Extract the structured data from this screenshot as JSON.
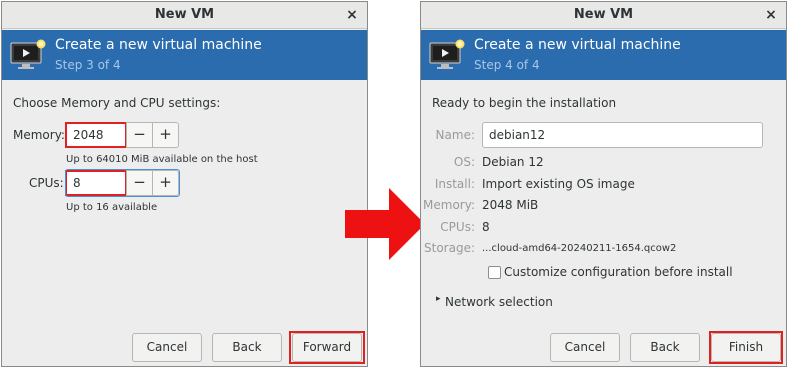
{
  "left": {
    "window_title": "New VM",
    "close_glyph": "×",
    "banner_title": "Create a new virtual machine",
    "banner_step": "Step 3 of 4",
    "heading": "Choose Memory and CPU settings:",
    "memory_label": "Memory:",
    "memory_value": "2048",
    "memory_hint": "Up to 64010 MiB available on the host",
    "cpus_label": "CPUs:",
    "cpus_value": "8",
    "cpus_hint": "Up to 16 available",
    "minus_glyph": "−",
    "plus_glyph": "+",
    "buttons": {
      "cancel": "Cancel",
      "back": "Back",
      "forward": "Forward"
    }
  },
  "right": {
    "window_title": "New VM",
    "close_glyph": "×",
    "banner_title": "Create a new virtual machine",
    "banner_step": "Step 4 of 4",
    "heading": "Ready to begin the installation",
    "name_label": "Name:",
    "name_value": "debian12",
    "os_label": "OS:",
    "os_value": "Debian 12",
    "install_label": "Install:",
    "install_value": "Import existing OS image",
    "memory_label": "Memory:",
    "memory_value": "2048 MiB",
    "cpus_label": "CPUs:",
    "cpus_value": "8",
    "storage_label": "Storage:",
    "storage_value": "...cloud-amd64-20240211-1654.qcow2",
    "customize_label": "Customize configuration before install",
    "customize_checked": false,
    "network_label": "Network selection",
    "network_expander_glyph": "▸",
    "buttons": {
      "cancel": "Cancel",
      "back": "Back",
      "finish": "Finish"
    }
  },
  "colors": {
    "banner": "#2a6cae",
    "banner_step_text": "#a7c7e9",
    "highlight_red": "#e02121",
    "focus_blue": "#4a90d9",
    "arrow_red": "#ee1111"
  },
  "icons": [
    "vm-monitor-icon",
    "close-icon",
    "minus-icon",
    "plus-icon",
    "checkbox-icon",
    "expander-arrow-icon",
    "red-arrow-icon"
  ]
}
